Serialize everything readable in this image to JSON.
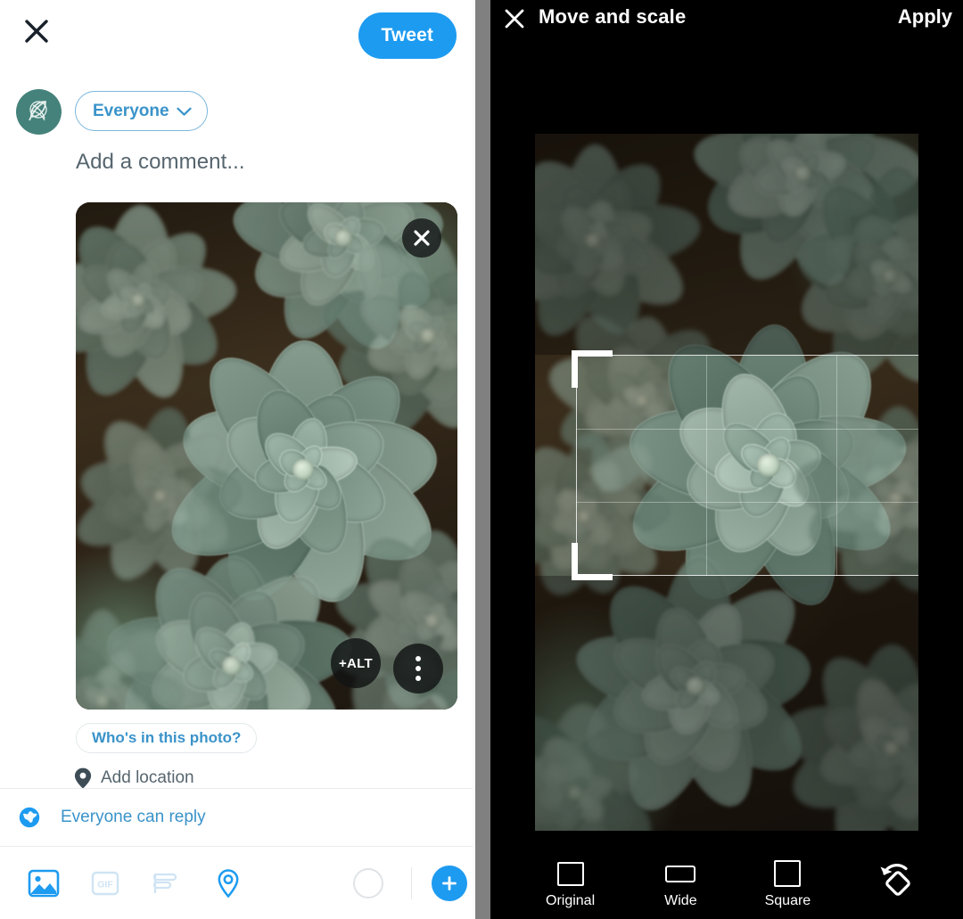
{
  "compose": {
    "close_icon": "close-icon",
    "tweet_label": "Tweet",
    "avatar_icon": "leaf-globe-avatar",
    "audience_label": "Everyone",
    "audience_chevron": "chevron-down-icon",
    "comment_placeholder": "Add a comment...",
    "image_close_icon": "close-icon",
    "alt_badge_label": "+ALT",
    "more_icon": "more-vertical-icon",
    "tag_people_label": "Who's in this photo?",
    "add_location_label": "Add location",
    "location_pin_icon": "location-pin-icon",
    "reply_scope_label": "Everyone can reply",
    "reply_scope_icon": "globe-icon",
    "tools": [
      {
        "name": "media-icon",
        "label": "Media"
      },
      {
        "name": "gif-icon",
        "label": "GIF"
      },
      {
        "name": "poll-icon",
        "label": "Poll"
      },
      {
        "name": "location-icon",
        "label": "Location"
      },
      {
        "name": "progress-circle-icon",
        "label": "Character count"
      }
    ],
    "add_button_icon": "plus-icon"
  },
  "cropper": {
    "close_icon": "close-icon",
    "title": "Move and scale",
    "apply_label": "Apply",
    "ratios": [
      {
        "label": "Original",
        "icon": "rect-original-icon",
        "selected": false
      },
      {
        "label": "Wide",
        "icon": "rect-wide-icon",
        "selected": false
      },
      {
        "label": "Square",
        "icon": "rect-square-icon",
        "selected": false
      }
    ],
    "rotate_icon": "rotate-icon"
  },
  "colors": {
    "accent_blue": "#1d9bf0",
    "link_blue": "#3a93c9",
    "muted_text": "#56656e",
    "panel_dark": "#000000",
    "avatar_teal": "#45827b",
    "divider_gray": "#808080",
    "succulent_green": "#8fa89a",
    "photo_background": "#2a2016"
  }
}
